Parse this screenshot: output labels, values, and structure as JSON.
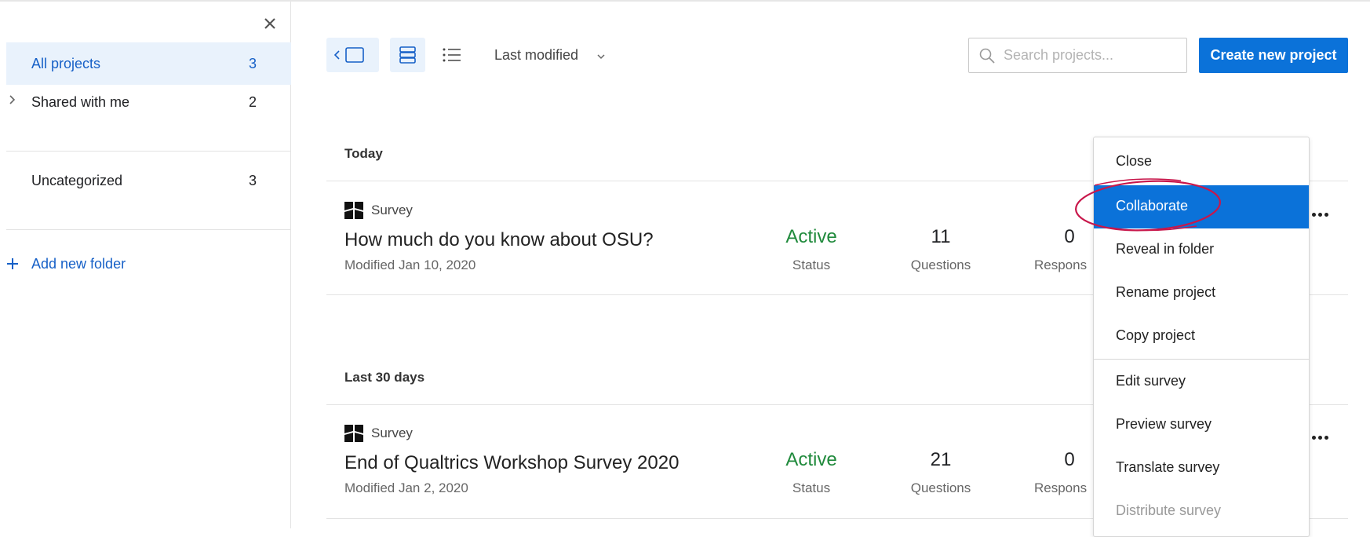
{
  "sidebar": {
    "close_icon": "close-icon",
    "items": [
      {
        "label": "All projects",
        "count": "3"
      },
      {
        "label": "Shared with me",
        "count": "2"
      },
      {
        "label": "Uncategorized",
        "count": "3"
      }
    ],
    "add_folder_label": "Add new folder"
  },
  "toolbar": {
    "sort_label": "Last modified",
    "search_placeholder": "Search projects...",
    "create_label": "Create new project"
  },
  "groups": [
    {
      "header": "Today",
      "projects": [
        {
          "type": "Survey",
          "name": "How much do you know about OSU?",
          "modified": "Modified Jan 10, 2020",
          "status": "Active",
          "status_label": "Status",
          "questions": "11",
          "questions_label": "Questions",
          "responses": "0",
          "responses_label": "Respons"
        }
      ]
    },
    {
      "header": "Last 30 days",
      "projects": [
        {
          "type": "Survey",
          "name": "End of Qualtrics Workshop Survey 2020",
          "modified": "Modified Jan 2, 2020",
          "status": "Active",
          "status_label": "Status",
          "questions": "21",
          "questions_label": "Questions",
          "responses": "0",
          "responses_label": "Respons"
        }
      ]
    }
  ],
  "menu": {
    "items": [
      {
        "label": "Close"
      },
      {
        "label": "Collaborate"
      },
      {
        "label": "Reveal in folder"
      },
      {
        "label": "Rename project"
      },
      {
        "label": "Copy project"
      },
      {
        "label": "Edit survey"
      },
      {
        "label": "Preview survey"
      },
      {
        "label": "Translate survey"
      },
      {
        "label": "Distribute survey"
      }
    ]
  },
  "colors": {
    "accent": "#0b72d9",
    "active_bg": "#e9f2fc",
    "status_green": "#208a3c",
    "annotation": "#c8174b"
  }
}
